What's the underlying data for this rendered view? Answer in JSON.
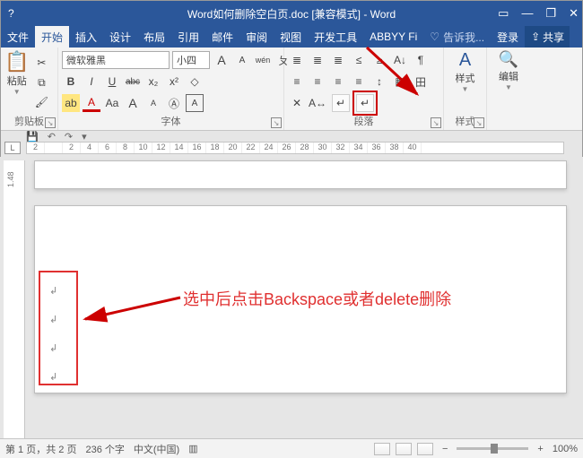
{
  "titlebar": {
    "title": "Word如何删除空白页.doc [兼容模式] - Word",
    "help_icon": "?",
    "ribbon_opts": "▭",
    "min": "—",
    "restore": "❐",
    "close": "✕"
  },
  "tabs": {
    "file": "文件",
    "home": "开始",
    "insert": "插入",
    "design": "设计",
    "layout": "布局",
    "references": "引用",
    "mailings": "邮件",
    "review": "审阅",
    "view": "视图",
    "developer": "开发工具",
    "abbyy": "ABBYY Fi",
    "tellme_icon": "♡",
    "tellme": "告诉我...",
    "signin": "登录",
    "share_icon": "⇪",
    "share": "共享"
  },
  "ribbon": {
    "clipboard": {
      "label": "剪贴板",
      "paste": "粘贴",
      "paste_icon": "📋",
      "cut": "✂",
      "copy": "⧉",
      "fmt": "🖌"
    },
    "font": {
      "label": "字体",
      "name": "微软雅黑",
      "size": "小四",
      "grow": "A",
      "shrink": "A",
      "wen": "wén",
      "bopomofo": "ㄆ",
      "bold": "B",
      "italic": "I",
      "underline": "U",
      "strike": "abc",
      "sub": "x₂",
      "sup": "x²",
      "clear": "◇",
      "highlight": "ab",
      "fontcolor": "A",
      "case": "Aa",
      "bigA": "A",
      "smallA": "A",
      "circleA": "Ⓐ",
      "charborder": "A"
    },
    "para": {
      "label": "段落",
      "bullets": "≣",
      "numbering": "≣",
      "multilevel": "≣",
      "dec": "≤",
      "inc": "≥",
      "sort": "A↓",
      "show": "¶",
      "alignL": "≡",
      "alignC": "≡",
      "alignR": "≡",
      "alignJ": "≡",
      "linespacing": "↕",
      "shading": "▦",
      "borders": "田",
      "asian1": "✕",
      "asian2": "A↔",
      "btn_highlighted": "↵"
    },
    "styles": {
      "label": "样式",
      "btn": "样式",
      "icon": "A"
    },
    "editing": {
      "label": "",
      "btn": "编辑",
      "icon": "🔍"
    }
  },
  "ruler": {
    "numbers": [
      "2",
      "",
      "2",
      "4",
      "6",
      "8",
      "10",
      "12",
      "14",
      "16",
      "18",
      "20",
      "22",
      "24",
      "26",
      "28",
      "30",
      "32",
      "34",
      "36",
      "38",
      "40"
    ],
    "corner": "L",
    "v": "1.48"
  },
  "qat": {
    "save": "💾",
    "undo": "↶",
    "redo": "↷",
    "more": "▾"
  },
  "doc": {
    "annotation": "选中后点击Backspace或者delete删除",
    "paramark": "↲"
  },
  "status": {
    "page": "第 1 页，共 2 页",
    "words": "236 个字",
    "lang": "中文(中国)",
    "track": "▥",
    "zoom_minus": "−",
    "zoom_plus": "+",
    "zoom": "100%"
  }
}
